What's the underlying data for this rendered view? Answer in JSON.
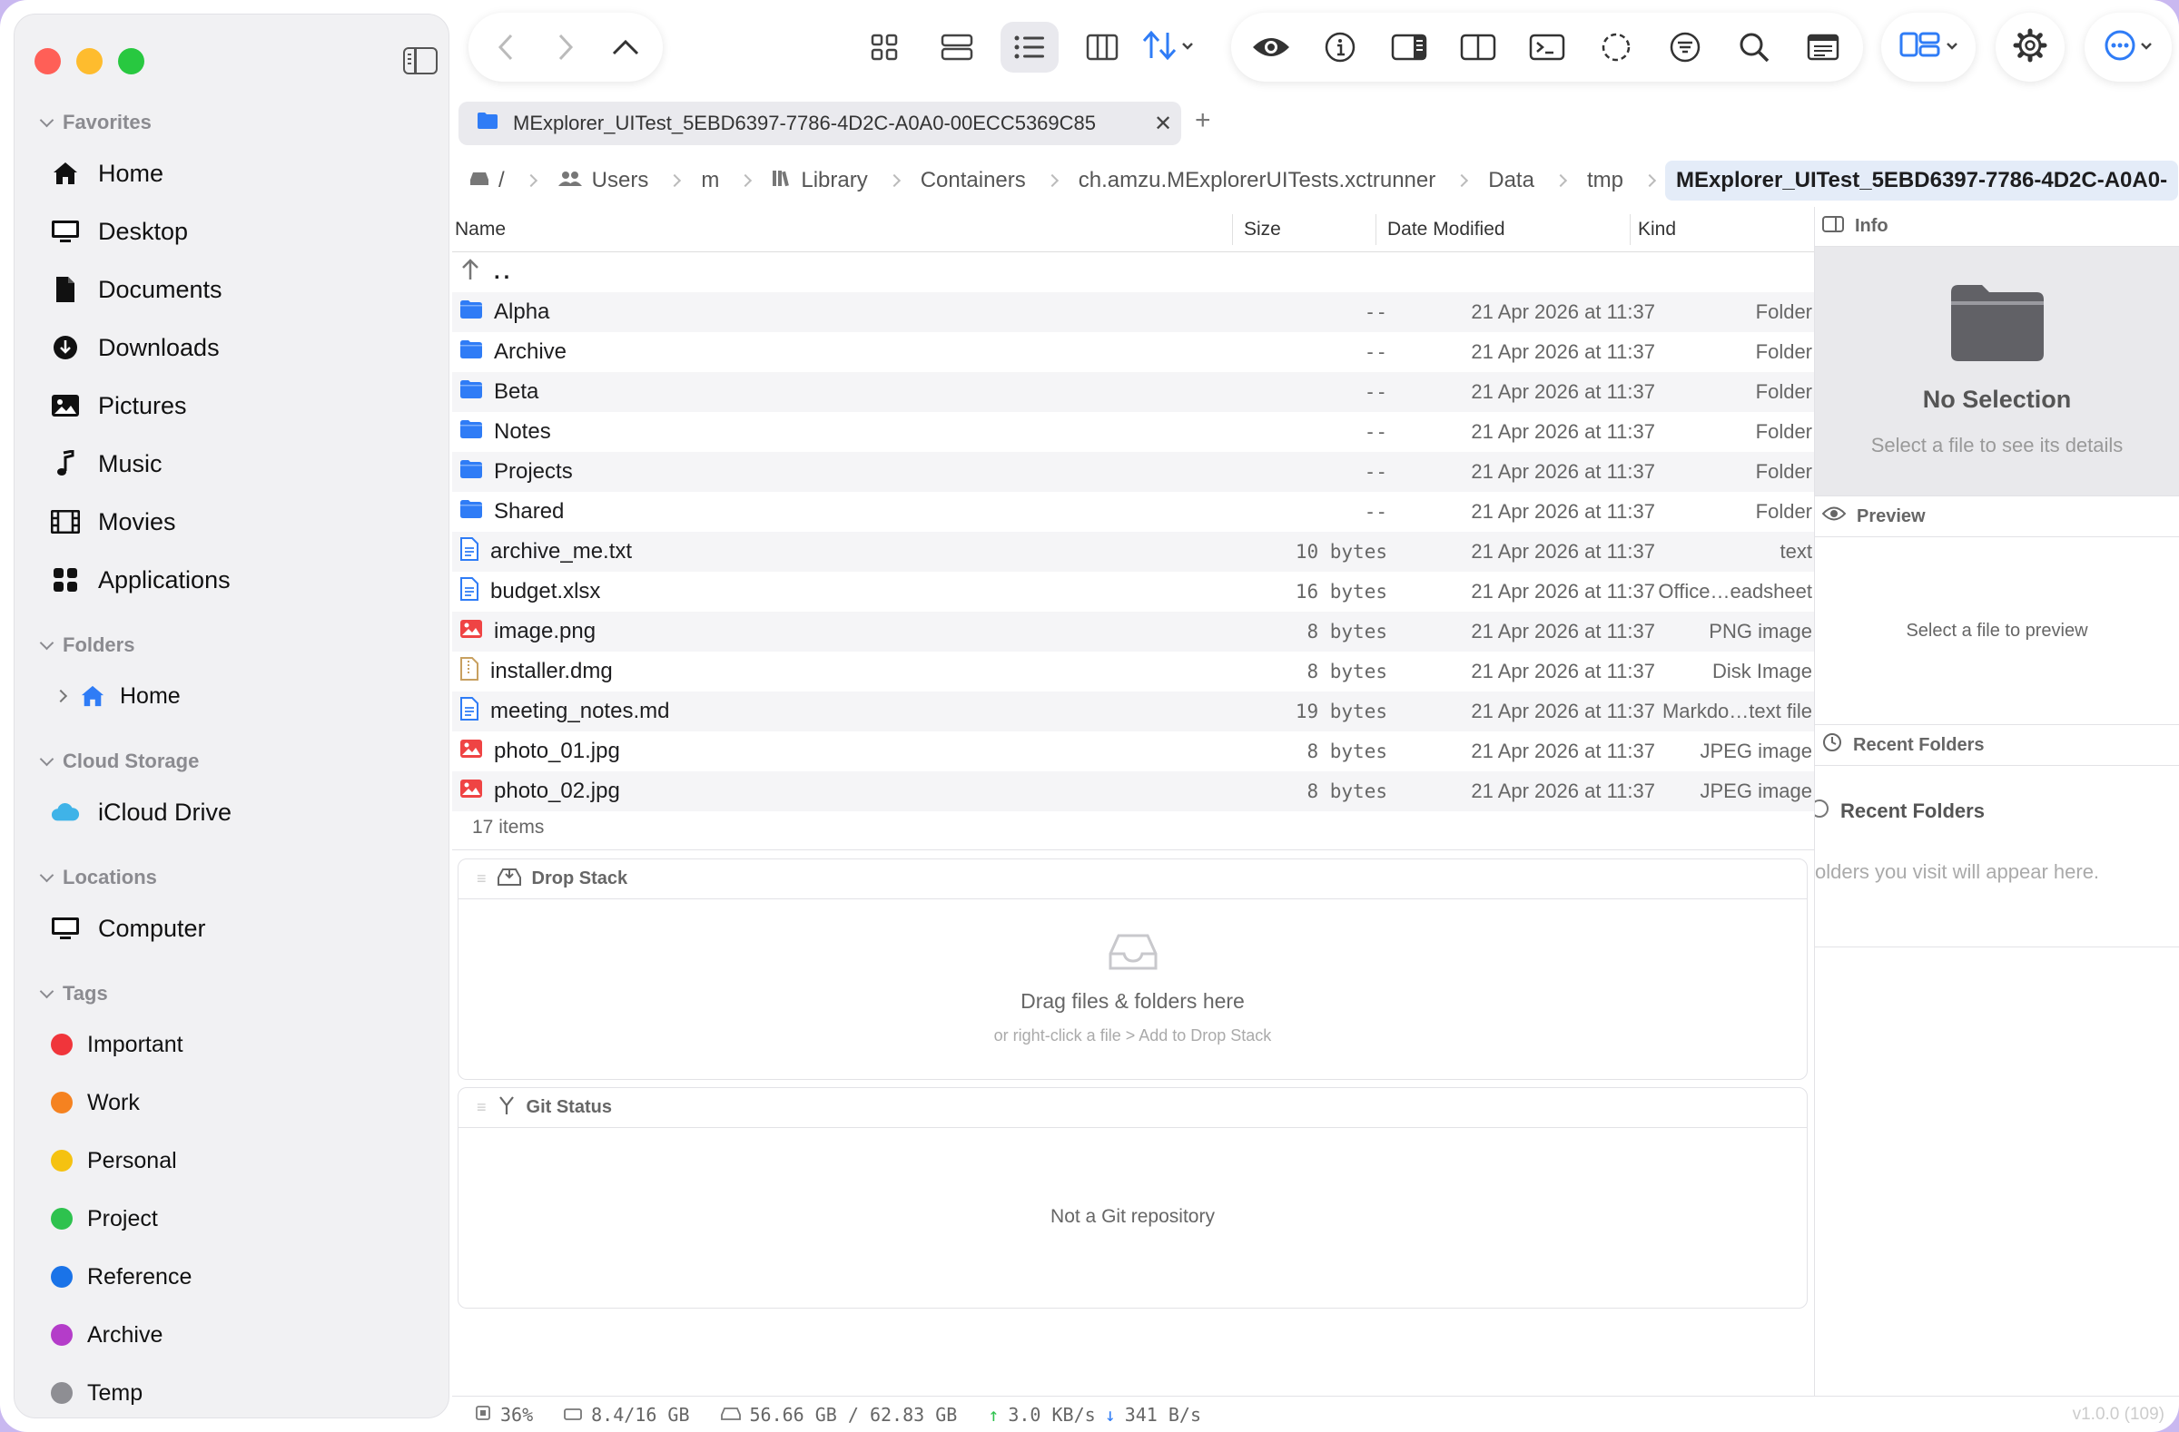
{
  "colors": {
    "close": "#ff5f57",
    "minimize": "#febc2e",
    "maximize": "#28c840",
    "accent": "#2f7cf6"
  },
  "sidebar": {
    "favorites_label": "Favorites",
    "favorites": [
      {
        "label": "Home",
        "icon": "house-icon"
      },
      {
        "label": "Desktop",
        "icon": "display-icon"
      },
      {
        "label": "Documents",
        "icon": "document-icon"
      },
      {
        "label": "Downloads",
        "icon": "download-icon"
      },
      {
        "label": "Pictures",
        "icon": "photo-icon"
      },
      {
        "label": "Music",
        "icon": "music-note-icon"
      },
      {
        "label": "Movies",
        "icon": "film-icon"
      },
      {
        "label": "Applications",
        "icon": "apps-grid-icon"
      }
    ],
    "folders_label": "Folders",
    "folders": [
      {
        "label": "Home",
        "icon": "house-icon"
      }
    ],
    "cloud_label": "Cloud Storage",
    "cloud": [
      {
        "label": "iCloud Drive",
        "icon": "cloud-icon"
      }
    ],
    "locations_label": "Locations",
    "locations": [
      {
        "label": "Computer",
        "icon": "display-icon"
      }
    ],
    "tags_label": "Tags",
    "tags": [
      {
        "label": "Important",
        "color": "#f0353b"
      },
      {
        "label": "Work",
        "color": "#f58220"
      },
      {
        "label": "Personal",
        "color": "#f5c211"
      },
      {
        "label": "Project",
        "color": "#2ec24e"
      },
      {
        "label": "Reference",
        "color": "#1a73e8"
      },
      {
        "label": "Archive",
        "color": "#b43cc9"
      },
      {
        "label": "Temp",
        "color": "#8e8e93"
      }
    ]
  },
  "tab": {
    "title": "MExplorer_UITest_5EBD6397-7786-4D2C-A0A0-00ECC5369C85"
  },
  "breadcrumb": [
    {
      "label": "/"
    },
    {
      "label": "Users"
    },
    {
      "label": "m"
    },
    {
      "label": "Library"
    },
    {
      "label": "Containers"
    },
    {
      "label": "ch.amzu.MExplorerUITests.xctrunner"
    },
    {
      "label": "Data"
    },
    {
      "label": "tmp"
    },
    {
      "label": "MExplorer_UITest_5EBD6397-7786-4D2C-A0A0-"
    }
  ],
  "list": {
    "columns": {
      "name": "Name",
      "size": "Size",
      "date": "Date Modified",
      "kind": "Kind"
    },
    "parent": "..",
    "rows": [
      {
        "name": "Alpha",
        "size": "--",
        "date": "21 Apr 2026 at 11:37",
        "kind": "Folder",
        "icon": "folder-icon"
      },
      {
        "name": "Archive",
        "size": "--",
        "date": "21 Apr 2026 at 11:37",
        "kind": "Folder",
        "icon": "folder-icon"
      },
      {
        "name": "Beta",
        "size": "--",
        "date": "21 Apr 2026 at 11:37",
        "kind": "Folder",
        "icon": "folder-icon"
      },
      {
        "name": "Notes",
        "size": "--",
        "date": "21 Apr 2026 at 11:37",
        "kind": "Folder",
        "icon": "folder-icon"
      },
      {
        "name": "Projects",
        "size": "--",
        "date": "21 Apr 2026 at 11:37",
        "kind": "Folder",
        "icon": "folder-icon"
      },
      {
        "name": "Shared",
        "size": "--",
        "date": "21 Apr 2026 at 11:37",
        "kind": "Folder",
        "icon": "folder-icon"
      },
      {
        "name": "archive_me.txt",
        "size": "10 bytes",
        "date": "21 Apr 2026 at 11:37",
        "kind": "text",
        "icon": "text-file-icon"
      },
      {
        "name": "budget.xlsx",
        "size": "16 bytes",
        "date": "21 Apr 2026 at 11:37",
        "kind": "Office…eadsheet",
        "icon": "text-file-icon"
      },
      {
        "name": "image.png",
        "size": "8 bytes",
        "date": "21 Apr 2026 at 11:37",
        "kind": "PNG image",
        "icon": "image-file-icon"
      },
      {
        "name": "installer.dmg",
        "size": "8 bytes",
        "date": "21 Apr 2026 at 11:37",
        "kind": "Disk Image",
        "icon": "archive-file-icon"
      },
      {
        "name": "meeting_notes.md",
        "size": "19 bytes",
        "date": "21 Apr 2026 at 11:37",
        "kind": "Markdo…text file",
        "icon": "text-file-icon"
      },
      {
        "name": "photo_01.jpg",
        "size": "8 bytes",
        "date": "21 Apr 2026 at 11:37",
        "kind": "JPEG image",
        "icon": "image-file-icon"
      },
      {
        "name": "photo_02.jpg",
        "size": "8 bytes",
        "date": "21 Apr 2026 at 11:37",
        "kind": "JPEG image",
        "icon": "image-file-icon"
      }
    ],
    "item_count": "17 items"
  },
  "drop_stack": {
    "title": "Drop Stack",
    "message": "Drag files & folders here",
    "hint": "or right-click a file > Add to Drop Stack"
  },
  "git_status": {
    "title": "Git Status",
    "message": "Not a Git repository"
  },
  "info_panel": {
    "info_title": "Info",
    "no_selection": "No Selection",
    "no_selection_hint": "Select a file to see its details",
    "preview_title": "Preview",
    "preview_hint": "Select a file to preview",
    "recent_title": "Recent Folders",
    "recent_heading": "Recent Folders",
    "recent_hint": "olders you visit will appear here."
  },
  "status": {
    "cpu": "36%",
    "memory": "8.4/16 GB",
    "disk": "56.66 GB / 62.83 GB",
    "up": "3.0 KB/s",
    "down": "341 B/s",
    "version": "v1.0.0 (109)"
  }
}
